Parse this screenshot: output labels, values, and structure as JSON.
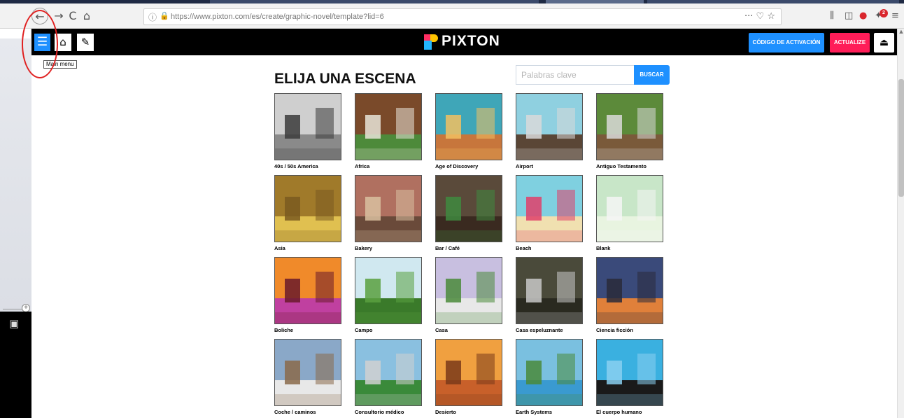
{
  "browser": {
    "url": "https://www.pixton.com/es/create/graphic-novel/template?lid=6",
    "nav": {
      "back": "←",
      "forward": "→",
      "reload": "C",
      "home": "⌂"
    },
    "url_actions": "··· ♡ ☆",
    "toolbar_icons": [
      "library-icon",
      "sidebar-icon",
      "adblock-icon",
      "extension-icon",
      "menu-icon"
    ],
    "extension_badge": "2"
  },
  "app": {
    "logo_text": "PIXTON",
    "menu_icon": "☰",
    "home_icon": "⌂",
    "edit_icon": "✎",
    "activation_label": "CÓDIGO DE ACTIVACIÓN",
    "upgrade_label": "ACTUALIZE",
    "eject_icon": "⏏",
    "tooltip": "Main menu"
  },
  "page": {
    "title": "ELIJA UNA ESCENA",
    "search_placeholder": "Palabras clave",
    "search_button": "BUSCAR"
  },
  "scenes": [
    {
      "label": "40s / 50s America",
      "colors": [
        "#cfcfcf",
        "#8a8a8a",
        "#3b3b3b"
      ]
    },
    {
      "label": "Africa",
      "colors": [
        "#7a4a2a",
        "#4d8a3a",
        "#e8e4d8"
      ]
    },
    {
      "label": "Age of Discovery",
      "colors": [
        "#3fa6b8",
        "#c7763c",
        "#f2c060"
      ]
    },
    {
      "label": "Airport",
      "colors": [
        "#8fd0e0",
        "#5a4636",
        "#d9d9d9"
      ]
    },
    {
      "label": "Antiguo Testamento",
      "colors": [
        "#5c8a3a",
        "#7a5a3a",
        "#d9d9d9"
      ]
    },
    {
      "label": "Asia",
      "colors": [
        "#a07a2a",
        "#e0c050",
        "#7a5a20"
      ]
    },
    {
      "label": "Bakery",
      "colors": [
        "#b07060",
        "#6a4a3a",
        "#d9c0a0"
      ]
    },
    {
      "label": "Bar / Café",
      "colors": [
        "#5a4a3a",
        "#3a2a20",
        "#3f8a3f"
      ]
    },
    {
      "label": "Beach",
      "colors": [
        "#7fd0e0",
        "#f0e0b0",
        "#e0406a"
      ]
    },
    {
      "label": "Blank",
      "colors": [
        "#c8e6c8",
        "#e8f4e0",
        "#f4f4f4"
      ]
    },
    {
      "label": "Boliche",
      "colors": [
        "#f08a2a",
        "#c040a0",
        "#6a1a2a"
      ]
    },
    {
      "label": "Campo",
      "colors": [
        "#d0e8f0",
        "#3a7a2a",
        "#5aa040"
      ]
    },
    {
      "label": "Casa",
      "colors": [
        "#c8bfe0",
        "#e8e8e8",
        "#4a8a3a"
      ]
    },
    {
      "label": "Casa espeluznante",
      "colors": [
        "#4a4a3a",
        "#2a2a20",
        "#c8c8c8"
      ]
    },
    {
      "label": "Ciencia ficción",
      "colors": [
        "#3a4a7a",
        "#e0803a",
        "#2a2a3a"
      ]
    },
    {
      "label": "Coche / caminos",
      "colors": [
        "#8aa8c8",
        "#e8e8e8",
        "#8a6a4a"
      ]
    },
    {
      "label": "Consultorio médico",
      "colors": [
        "#8ac0e0",
        "#3a8a3a",
        "#d0d0d0"
      ]
    },
    {
      "label": "Desierto",
      "colors": [
        "#f0a040",
        "#c8602a",
        "#7a3a1a"
      ]
    },
    {
      "label": "Earth Systems",
      "colors": [
        "#7ac0e0",
        "#3a9ad0",
        "#4a8a3a"
      ]
    },
    {
      "label": "El cuerpo humano",
      "colors": [
        "#3ab0e0",
        "#1a1a1a",
        "#8ad0f0"
      ]
    }
  ]
}
